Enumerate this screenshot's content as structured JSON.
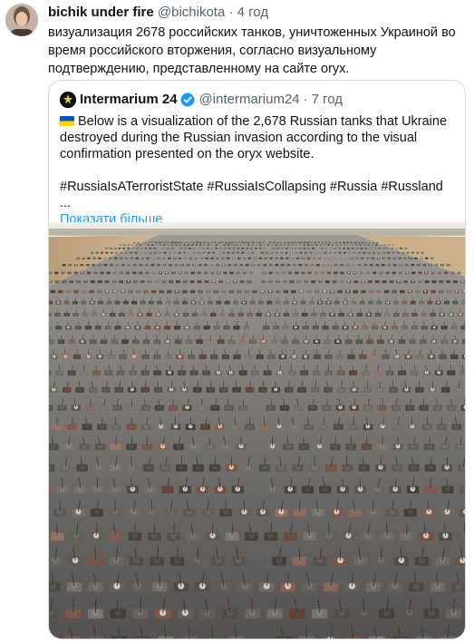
{
  "tweet": {
    "display_name": "bichik under fire",
    "handle": "@bichikota",
    "separator": "·",
    "time": "4 год",
    "text": "визуализация 2678 российских танков, уничтоженных Украиной во время российского вторжения, согласно визуальному подтверждению, представленному на сайте oryx."
  },
  "quote": {
    "display_name": "Intermarium 24",
    "handle": "@intermarium24",
    "separator": "·",
    "time": "7 год",
    "text_line1": "Below is a visualization of the 2,678 Russian tanks that Ukraine destroyed during the Russian invasion according to the visual confirmation presented on the oryx website.",
    "hashtags": "#RussiaIsATerroristState #RussiaIsCollapsing #Russia #Russland ...",
    "show_more": "Показати більше",
    "icons": {
      "avatar": "avatar-icon",
      "verified": "verified-badge-icon",
      "flag": "ukraine-flag-icon"
    }
  },
  "colors": {
    "link": "#1d9bf0",
    "muted": "#536471",
    "border": "#cfd9de"
  }
}
